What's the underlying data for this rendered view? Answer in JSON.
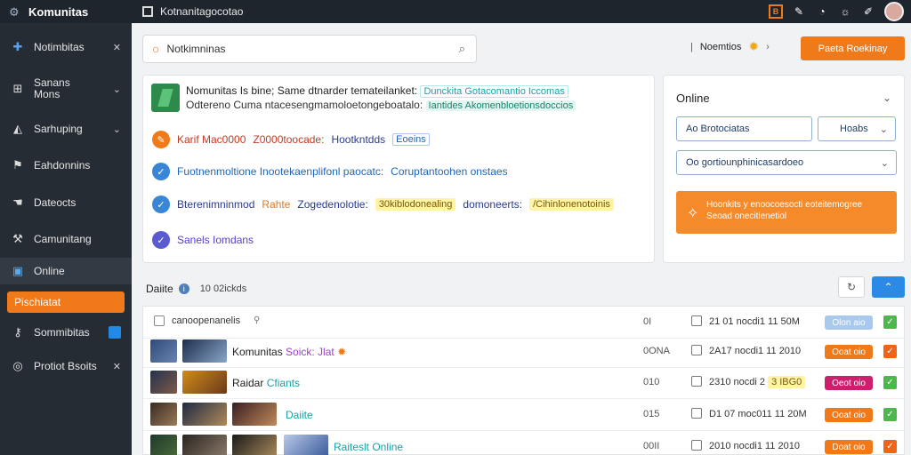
{
  "app": {
    "brand": "Komunitas",
    "window_title": "Kotnanitagocotao"
  },
  "sidebar": {
    "items": [
      {
        "label": "Notimbitas",
        "icon": "puzzle-icon"
      },
      {
        "label1": "Sanans",
        "label2": "Mons",
        "icon": "grid-icon"
      },
      {
        "label": "Sarhuping",
        "icon": "chart-icon"
      },
      {
        "label": "Eahdonnins",
        "icon": "flag-icon"
      },
      {
        "label": "Dateocts",
        "icon": "hand-icon"
      },
      {
        "label": "Camunitang",
        "icon": "tool-icon"
      },
      {
        "label": "Online",
        "icon": "monitor-icon"
      },
      {
        "label": "Pischiatat"
      },
      {
        "label": "Sommibitas",
        "icon": "key-icon"
      },
      {
        "label": "Protiot Bsoits",
        "icon": "globe-icon"
      }
    ]
  },
  "search": {
    "value": "Notkimninas"
  },
  "header_right": {
    "label": "Noemtios",
    "button": "Paeta Roekinay"
  },
  "main_card": {
    "line1_text": "Nomunitas Is bine; Same dtnarder temateilanket:",
    "line1_tag": "Dunckita Gotacomantio Iccomas",
    "line2_text": "Odtereno Cuma ntacesengmamoloetongeboatalo:",
    "line2_tag": "Iantides Akomenbloetionsdoccios",
    "row1": {
      "a": "Karif Mac0000",
      "b": "Z0000toocade:",
      "c": "Hootkntdds",
      "d": "Eoeins"
    },
    "row2": {
      "a": "Fuotnenmoltione Inootekaenplifonl paocatc:",
      "b": "Coruptantoohen onstaes"
    },
    "row3": {
      "a": "Bterenimninmod",
      "b": "Rahte",
      "c": "Zogedenolotie:",
      "d": "30kiblodonealing",
      "e": "domoneerts:",
      "f": "/Cihinlonenotoinis"
    },
    "row4": {
      "a": "Sanels Iomdans"
    }
  },
  "online_card": {
    "title": "Online",
    "field1": "Ao Brotociatas",
    "field2": "Hoabs",
    "select": "Oo gortiounphinicasardoeo",
    "panel_line1": "Hoonkits y enoocoesocti eoteitemogree",
    "panel_line2": "Seoad onecitienetiol"
  },
  "table": {
    "title": "Daiite",
    "count": "10 02ickds",
    "header_label": "canoopenanelis",
    "rows": [
      {
        "title_a": "Komunitas",
        "title_b": "Soick: Jlat",
        "code": "0ONA",
        "date": "2A17 nocdi1 11 2010",
        "status": "Ooat oio",
        "status_color": "orange",
        "check": "orange"
      },
      {
        "title_a": "Raidar",
        "title_b": "Cfiants",
        "code": "010",
        "date": "2310 nocdi 2",
        "date_pill": "3 IBG0",
        "status": "Oeot oio",
        "status_color": "magenta",
        "check": "green"
      },
      {
        "title_a": "",
        "title_b": "Daiite",
        "code": "015",
        "date": "D1 07 moc011 11 20M",
        "status": "Ooat oio",
        "status_color": "orange",
        "check": "green"
      },
      {
        "title_a": "",
        "title_b": "Raiteslt Online",
        "code": "00II",
        "date": "2010 nocdi1 11 2010",
        "status": "Doat oio",
        "status_color": "orange",
        "check": "orange"
      }
    ],
    "header_row": {
      "code": "0I",
      "date": "21 01 nocdi1 11 50M",
      "status": "Olon aio",
      "check": "green"
    }
  },
  "colors": {
    "accent": "#f07a1a",
    "sidebar_bg": "#262c34",
    "topbar_bg": "#1f252d",
    "blue": "#2a8ae6"
  }
}
